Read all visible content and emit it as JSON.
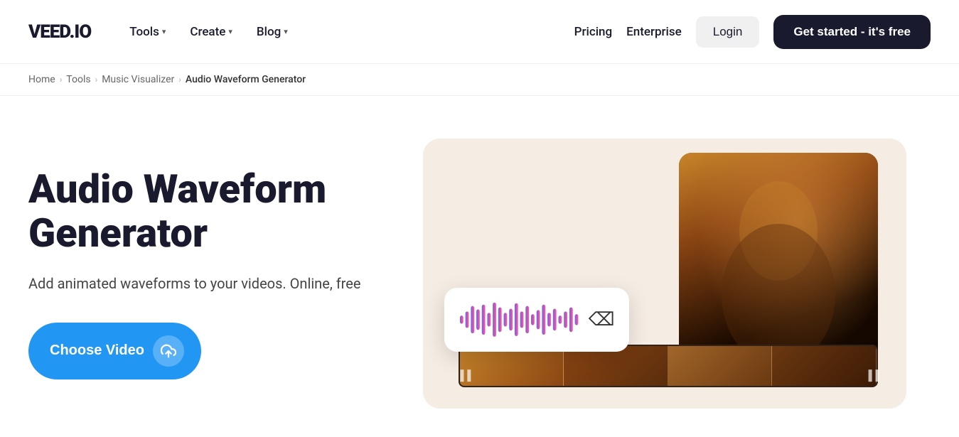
{
  "logo": "VEED.IO",
  "nav": {
    "left": [
      {
        "label": "Tools",
        "hasDropdown": true
      },
      {
        "label": "Create",
        "hasDropdown": true
      },
      {
        "label": "Blog",
        "hasDropdown": true
      }
    ],
    "right": [
      {
        "label": "Pricing",
        "id": "pricing"
      },
      {
        "label": "Enterprise",
        "id": "enterprise"
      }
    ],
    "login": "Login",
    "getstarted": "Get started - it's free"
  },
  "breadcrumb": {
    "items": [
      {
        "label": "Home",
        "id": "home"
      },
      {
        "label": "Tools",
        "id": "tools"
      },
      {
        "label": "Music Visualizer",
        "id": "music-visualizer"
      },
      {
        "label": "Audio Waveform Generator",
        "id": "audio-waveform",
        "current": true
      }
    ]
  },
  "hero": {
    "title": "Audio Waveform Generator",
    "subtitle": "Add animated waveforms to your videos. Online, free",
    "cta_button": "Choose Video"
  }
}
